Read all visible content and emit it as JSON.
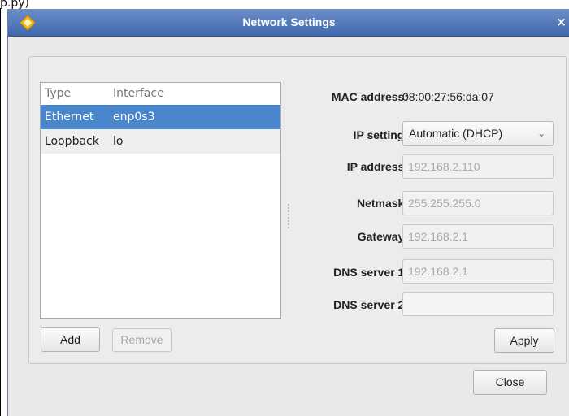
{
  "page": {
    "top_label": "p.py)"
  },
  "window": {
    "title": "Network Settings",
    "close_glyph": "×",
    "icon": "app-logo-icon"
  },
  "interfaces": {
    "headers": {
      "type": "Type",
      "interface": "Interface"
    },
    "rows": [
      {
        "type": "Ethernet",
        "interface": "enp0s3",
        "selected": true
      },
      {
        "type": "Loopback",
        "interface": "lo",
        "selected": false
      }
    ]
  },
  "buttons": {
    "add": "Add",
    "remove": "Remove",
    "apply": "Apply",
    "close": "Close"
  },
  "settings": {
    "mac_label": "MAC address:",
    "mac_value": "08:00:27:56:da:07",
    "ip_setting_label": "IP setting:",
    "ip_setting_value": "Automatic (DHCP)",
    "ip_address_label": "IP address:",
    "ip_address_value": "192.168.2.110",
    "netmask_label": "Netmask:",
    "netmask_value": "255.255.255.0",
    "gateway_label": "Gateway:",
    "gateway_value": "192.168.2.1",
    "dns1_label": "DNS server 1:",
    "dns1_value": "192.168.2.1",
    "dns2_label": "DNS server 2:",
    "dns2_value": ""
  },
  "colors": {
    "titlebar": "#4f76b8",
    "selection": "#4a86cc",
    "dialog_bg": "#e9e9e9"
  }
}
